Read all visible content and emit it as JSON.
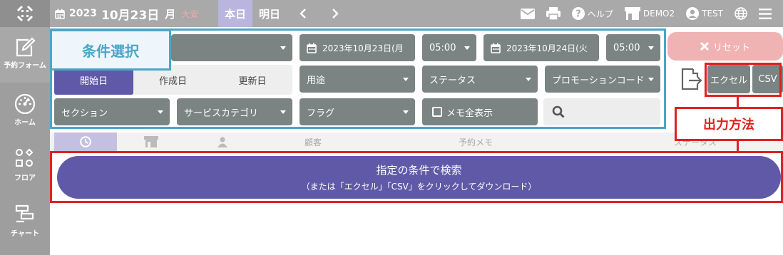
{
  "header": {
    "year": "2023",
    "month_day": "10月23日",
    "weekday": "月",
    "rokuyo": "大安",
    "today_label": "本日",
    "tomorrow_label": "明日",
    "help_label": "ヘルプ",
    "store_label": "DEMO2",
    "user_label": "TEST"
  },
  "sidebar": {
    "items": [
      {
        "label": "予約フォーム",
        "icon": "edit-icon"
      },
      {
        "label": "ホーム",
        "icon": "gauge-icon"
      },
      {
        "label": "フロア",
        "icon": "floor-icon"
      },
      {
        "label": "チャート",
        "icon": "chart-icon"
      }
    ]
  },
  "filters": {
    "date_type": {
      "options": [
        "開始日",
        "作成日",
        "更新日"
      ],
      "selected": "開始日"
    },
    "start_date": "2023年10月23日(月",
    "start_time": "05:00",
    "end_date": "2023年10月24日(火",
    "end_time": "05:00",
    "usage": "用途",
    "status": "ステータス",
    "promo_code": "プロモーションコード",
    "section": "セクション",
    "service_category": "サービスカテゴリ",
    "flag": "フラグ",
    "show_all_memo": "メモ全表示",
    "search_placeholder": ""
  },
  "actions": {
    "reset": "リセット",
    "excel": "エクセル",
    "csv": "CSV"
  },
  "table": {
    "columns": [
      "",
      "",
      "",
      "顧客",
      "予約メモ",
      "ステータス"
    ]
  },
  "search_button": {
    "line1": "指定の条件で検索",
    "line2": "（または「エクセル」「CSV」をクリックしてダウンロード）"
  },
  "annotations": {
    "conditions": "条件選択",
    "output": "出力方法"
  },
  "colors": {
    "topbar": "#a9a9a9",
    "sidebar": "#9e9e9e",
    "accent_purple": "#6059a8",
    "select_gray": "#7b8383",
    "annotation_blue": "#4aa6c8",
    "annotation_red": "#e02020"
  }
}
